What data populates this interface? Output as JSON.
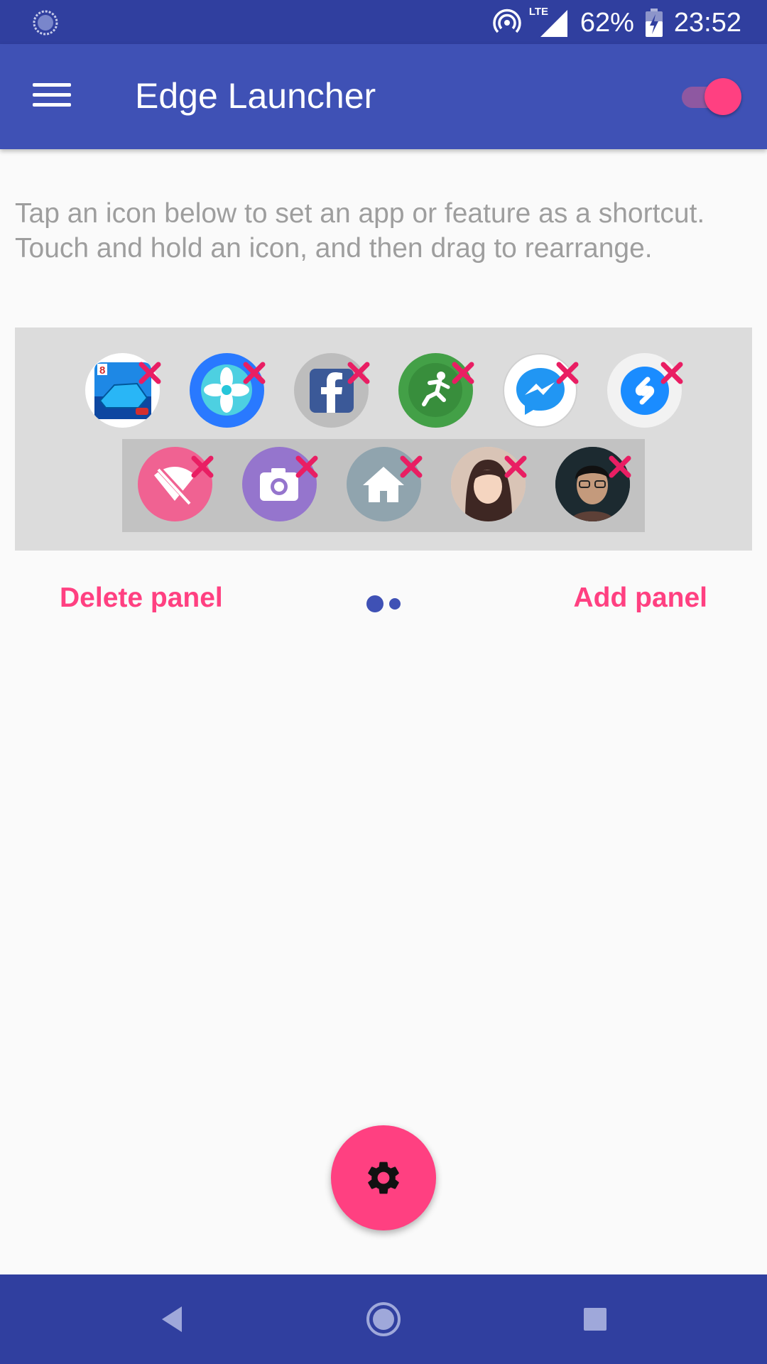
{
  "status_bar": {
    "battery": "62%",
    "time": "23:52",
    "network_label": "LTE",
    "icons": [
      "loading-icon",
      "hotspot-icon",
      "signal-icon",
      "battery-charging-icon"
    ]
  },
  "app_bar": {
    "title": "Edge Launcher",
    "menu_icon": "hamburger-icon",
    "toggle_on": true
  },
  "description": "Tap an icon below to set an app or feature as a shortcut. Touch and hold an icon, and then drag to rearrange.",
  "panel": {
    "row1": [
      {
        "name": "asphalt-8-app",
        "icon": "racing-car-icon"
      },
      {
        "name": "pinwheel-app",
        "icon": "pinwheel-icon"
      },
      {
        "name": "facebook-app",
        "icon": "facebook-icon"
      },
      {
        "name": "soccer-app",
        "icon": "soccer-player-icon"
      },
      {
        "name": "messenger-app",
        "icon": "messenger-icon"
      },
      {
        "name": "shazam-app",
        "icon": "shazam-icon"
      }
    ],
    "row2": [
      {
        "name": "wifi-off-shortcut",
        "icon": "wifi-off-icon"
      },
      {
        "name": "camera-shortcut",
        "icon": "camera-icon"
      },
      {
        "name": "home-shortcut",
        "icon": "home-icon"
      },
      {
        "name": "contact-woman",
        "icon": "avatar-icon"
      },
      {
        "name": "contact-man",
        "icon": "avatar-icon"
      }
    ]
  },
  "actions": {
    "delete_label": "Delete panel",
    "add_label": "Add panel",
    "page_count": 2,
    "current_page": 1
  },
  "fab_icon": "gear-icon",
  "nav_bar": {
    "icons": [
      "back-icon",
      "home-icon",
      "recents-icon"
    ]
  },
  "colors": {
    "primary": "#3f51b5",
    "primary_dark": "#303f9f",
    "accent": "#ff4081",
    "text_secondary": "#9e9e9e"
  }
}
